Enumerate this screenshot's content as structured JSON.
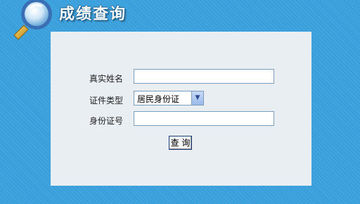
{
  "header": {
    "title": "成绩查询"
  },
  "form": {
    "name_label": "真实姓名",
    "name_value": "",
    "id_type_label": "证件类型",
    "id_type_selected": "居民身份证",
    "id_number_label": "身份证号",
    "id_number_value": "",
    "submit_label": "查 询"
  },
  "icons": {
    "logo": "magnifier-icon",
    "select_arrow": "chevron-down-icon"
  },
  "colors": {
    "background": "#3aa0dc",
    "panel": "#e9eef2",
    "input_border": "#7f9db9"
  }
}
